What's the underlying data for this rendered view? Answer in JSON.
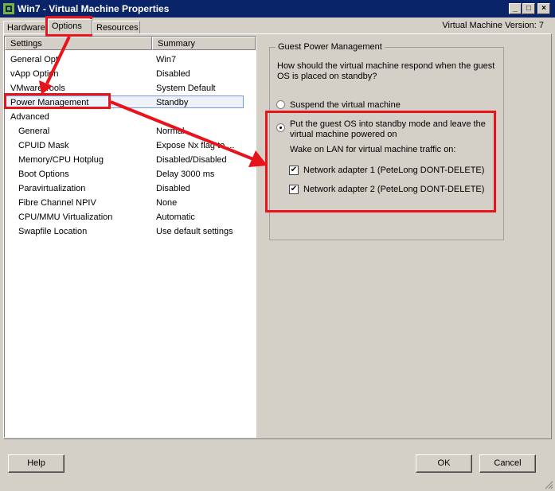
{
  "window": {
    "title": "Win7 - Virtual Machine Properties",
    "min_glyph": "_",
    "max_glyph": "□",
    "close_glyph": "×"
  },
  "tabs": [
    {
      "label": "Hardware"
    },
    {
      "label": "Options"
    },
    {
      "label": "Resources"
    }
  ],
  "vm_version": "Virtual Machine Version: 7",
  "list": {
    "header_settings": "Settings",
    "header_summary": "Summary",
    "rows": [
      {
        "setting": "General Opt",
        "summary": "Win7"
      },
      {
        "setting": "vApp Option",
        "summary": "Disabled"
      },
      {
        "setting": "VMware Tools",
        "summary": "System Default"
      },
      {
        "setting": "Power Management",
        "summary": "Standby"
      },
      {
        "setting": "Advanced",
        "summary": ""
      },
      {
        "setting": "General",
        "summary": "Normal"
      },
      {
        "setting": "CPUID Mask",
        "summary": "Expose Nx flag to ..."
      },
      {
        "setting": "Memory/CPU Hotplug",
        "summary": "Disabled/Disabled"
      },
      {
        "setting": "Boot Options",
        "summary": "Delay 3000 ms"
      },
      {
        "setting": "Paravirtualization",
        "summary": "Disabled"
      },
      {
        "setting": "Fibre Channel NPIV",
        "summary": "None"
      },
      {
        "setting": "CPU/MMU Virtualization",
        "summary": "Automatic"
      },
      {
        "setting": "Swapfile Location",
        "summary": "Use default settings"
      }
    ]
  },
  "power": {
    "group_title": "Guest Power Management",
    "question_line1": "How should the virtual machine respond when the guest",
    "question_line2": "OS is placed on standby?",
    "option_suspend": "Suspend the virtual machine",
    "option_standby_line1": "Put the guest OS into standby mode and leave the",
    "option_standby_line2": "virtual machine powered on",
    "wol_label": "Wake on LAN for virtual machine traffic on:",
    "adapters": [
      {
        "label": "Network adapter 1 (PeteLong DONT-DELETE)",
        "checked": true
      },
      {
        "label": "Network adapter 2 (PeteLong DONT-DELETE)",
        "checked": true
      }
    ],
    "check_glyph": "✔"
  },
  "buttons": {
    "help": "Help",
    "ok": "OK",
    "cancel": "Cancel"
  },
  "colors": {
    "titlebar": "#0a246a",
    "annotation_red": "#e8141b",
    "dialog_gray": "#d4d0c8"
  }
}
